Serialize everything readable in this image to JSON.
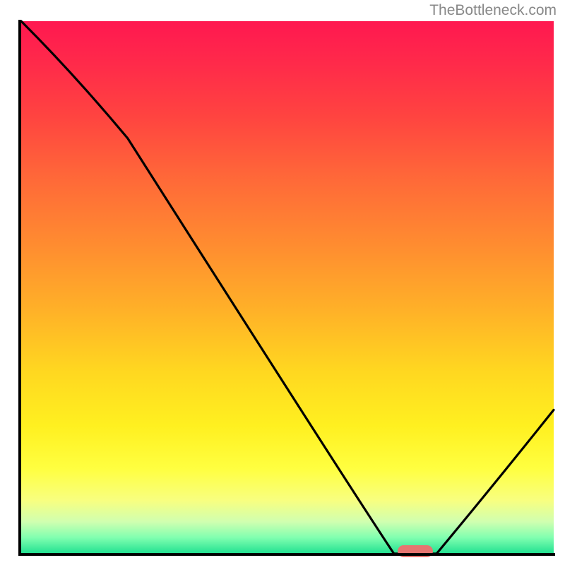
{
  "watermark": "TheBottleneck.com",
  "chart_data": {
    "type": "line",
    "title": "",
    "xlabel": "",
    "ylabel": "",
    "xlim": [
      0,
      100
    ],
    "ylim": [
      0,
      100
    ],
    "x": [
      0,
      20,
      70,
      78,
      100
    ],
    "values": [
      100,
      78,
      0,
      0,
      27
    ],
    "marker": {
      "x_center": 74,
      "y": 0,
      "color": "#e77570"
    },
    "gradient_stops": [
      {
        "pos": 0,
        "color": "#ff1850"
      },
      {
        "pos": 18,
        "color": "#ff4440"
      },
      {
        "pos": 42,
        "color": "#ff8c30"
      },
      {
        "pos": 66,
        "color": "#ffd820"
      },
      {
        "pos": 84,
        "color": "#ffff40"
      },
      {
        "pos": 97,
        "color": "#80ffb0"
      },
      {
        "pos": 100,
        "color": "#20e090"
      }
    ]
  }
}
